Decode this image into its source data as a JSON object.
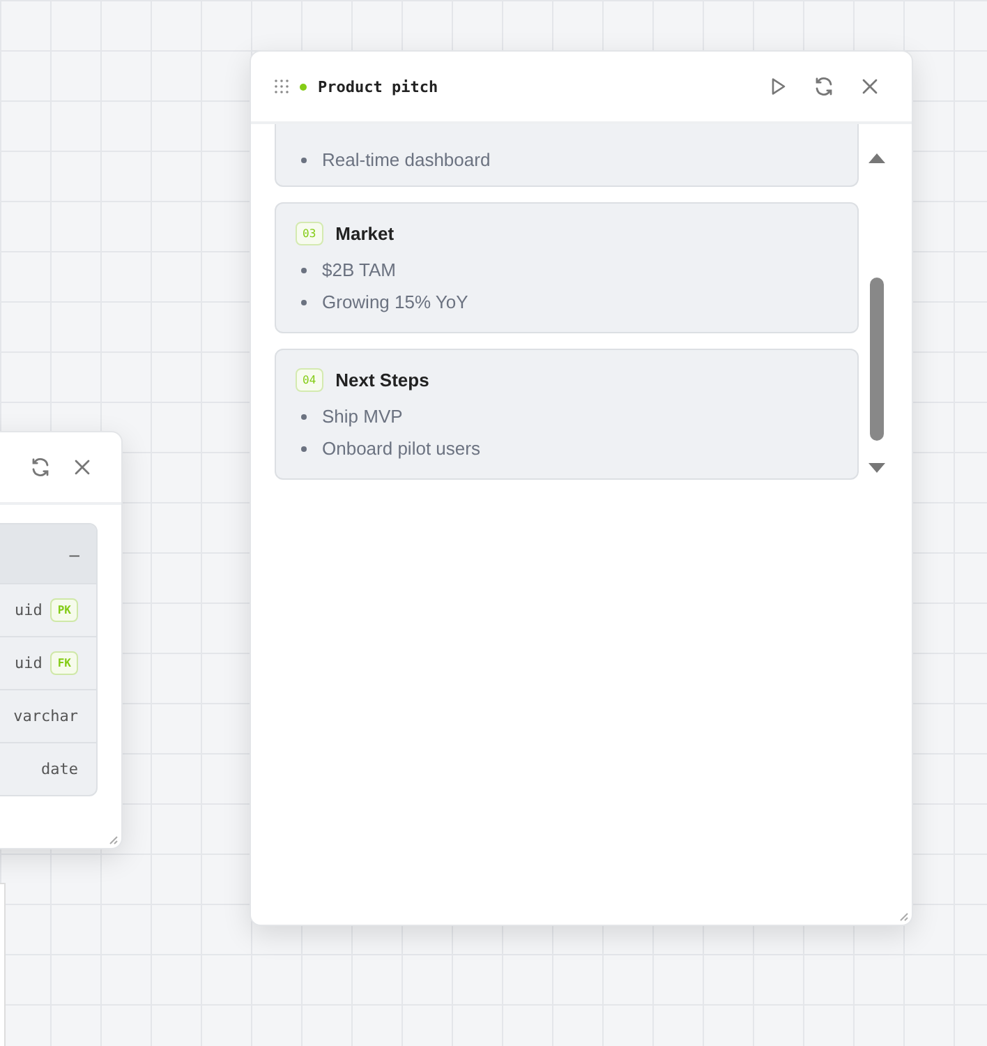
{
  "left_window": {
    "table": {
      "header_action": "–",
      "rows": [
        {
          "type": "uid",
          "key": "PK"
        },
        {
          "type": "uid",
          "key": "FK"
        },
        {
          "type": "varchar"
        },
        {
          "type": "date"
        }
      ]
    }
  },
  "window": {
    "title": "Product pitch",
    "sections": [
      {
        "partial": true,
        "items": [
          "Real-time dashboard"
        ]
      },
      {
        "partial": false,
        "number": "03",
        "title": "Market",
        "items": [
          "$2B TAM",
          "Growing 15% YoY"
        ]
      },
      {
        "partial": false,
        "number": "04",
        "title": "Next Steps",
        "items": [
          "Ship MVP",
          "Onboard pilot users"
        ]
      }
    ]
  }
}
